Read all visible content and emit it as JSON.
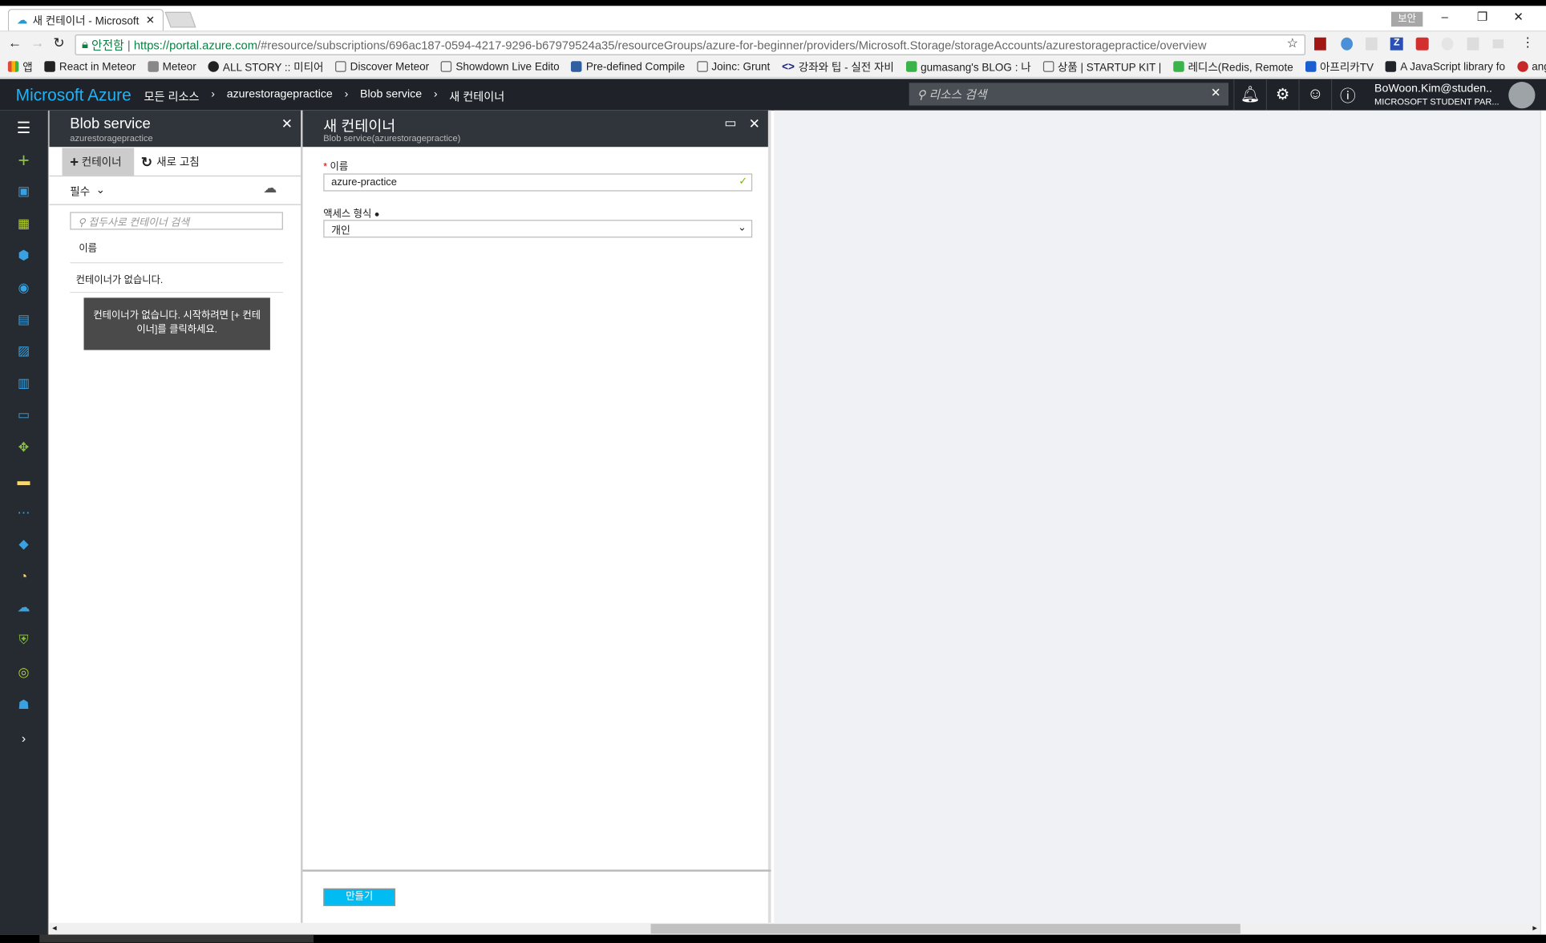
{
  "browser": {
    "tab_title": "새 컨테이너 - Microsoft",
    "security_label": "보안",
    "secure_label": "안전함",
    "url_host": "https://portal.azure.com",
    "url_path": "/#resource/subscriptions/696ac187-0594-4217-9296-b67979524a35/resourceGroups/azure-for-beginner/providers/Microsoft.Storage/storageAccounts/azurestoragepractice/overview",
    "bookmarks": [
      {
        "label": "앱",
        "color": "#e04a3c"
      },
      {
        "label": "React in Meteor",
        "color": "#222"
      },
      {
        "label": "Meteor",
        "color": "#888"
      },
      {
        "label": "ALL STORY :: 미티어",
        "color": "#222"
      },
      {
        "label": "Discover Meteor",
        "color": "#fff"
      },
      {
        "label": "Showdown Live Edito",
        "color": "#fff"
      },
      {
        "label": "Pre-defined Compile",
        "color": "#2f5fa0"
      },
      {
        "label": "Joinc: Grunt",
        "color": "#fff"
      },
      {
        "label": "강좌와 팁 - 실전 자비",
        "color": "#1a237e"
      },
      {
        "label": "gumasang's BLOG : 나",
        "color": "#3ab44a"
      },
      {
        "label": "상품 | STARTUP KIT |",
        "color": "#fff"
      },
      {
        "label": "레디스(Redis, Remote",
        "color": "#3ab44a"
      },
      {
        "label": "아프리카TV",
        "color": "#1a5fd0"
      },
      {
        "label": "A JavaScript library fo",
        "color": "#20232a"
      },
      {
        "label": "angular-meteor",
        "color": "#c62828"
      }
    ]
  },
  "header": {
    "brand": "Microsoft Azure",
    "breadcrumbs": [
      "모든 리소스",
      "azurestoragepractice",
      "Blob service",
      "새 컨테이너"
    ],
    "search_placeholder": "리소스 검색",
    "user_name": "BoWoon.Kim@studen..",
    "user_org": "MICROSOFT STUDENT PAR..."
  },
  "sidebar": {
    "icons": [
      "new-icon",
      "dashboard-icon",
      "all-resources-icon",
      "resource-groups-icon",
      "app-services-icon",
      "sql-database-icon",
      "virtual-machines-classic-icon",
      "storage-icon",
      "virtual-machines-icon",
      "load-balancer-icon",
      "subscriptions-icon",
      "virtual-network-icon",
      "cloud-service-icon",
      "monitor-icon",
      "active-directory-icon",
      "security-center-icon",
      "advisor-icon",
      "help-icon"
    ],
    "accent": "#8cc63f"
  },
  "blade1": {
    "title": "Blob service",
    "subtitle": "azurestoragepractice",
    "add_label": "컨테이너",
    "refresh_label": "새로 고침",
    "essentials_label": "필수",
    "search_placeholder": "접두사로 컨테이너 검색",
    "col_name": "이름",
    "empty_text": "컨테이너가 없습니다.",
    "tooltip": "컨테이너가 없습니다. 시작하려면 [+ 컨테이너]를 클릭하세요."
  },
  "blade2": {
    "title": "새 컨테이너",
    "subtitle": "Blob service(azurestoragepractice)",
    "name_label": "이름",
    "name_value": "azure-practice",
    "access_label": "액세스 형식",
    "access_value": "개인",
    "create_label": "만들기",
    "create_color": "#00bcf2"
  }
}
